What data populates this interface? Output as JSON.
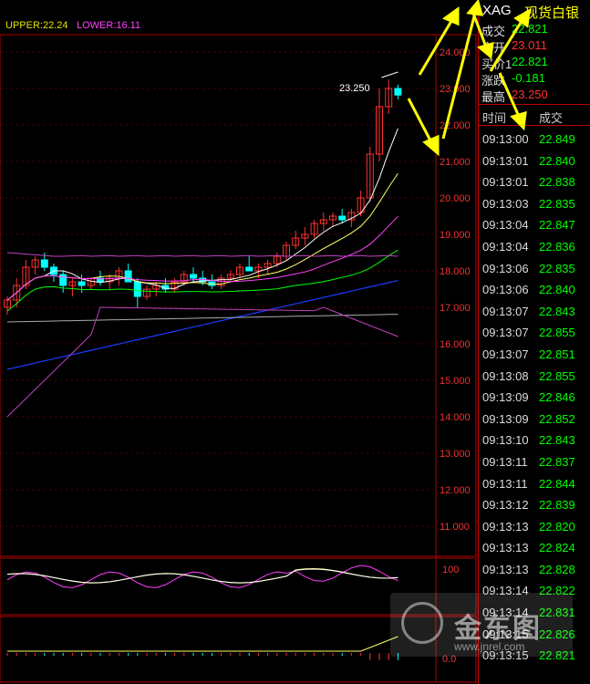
{
  "indicator": {
    "upper": "UPPER:22.24",
    "lower": "LOWER:16.11"
  },
  "price_tag": "23.250",
  "axis": {
    "main_labels": [
      "24.000",
      "23.000",
      "22.000",
      "21.000",
      "20.000",
      "19.000",
      "18.000",
      "17.000",
      "16.000",
      "15.000",
      "14.000",
      "13.000",
      "12.000",
      "11.000"
    ],
    "osc_labels": [
      "100"
    ],
    "vol_labels": [
      "0.0"
    ]
  },
  "colors": {
    "up": "#ff3030",
    "down": "#00ffff",
    "grid": "#b00000",
    "upper_band": "#e5e500",
    "lower_band": "#ff40ff",
    "ma_long": "#1a3cff"
  },
  "quote": {
    "symbol": "XAG",
    "name": "现货白银",
    "rows": [
      {
        "key": "成交",
        "value": "22.821",
        "color": "green"
      },
      {
        "key": "今开",
        "value": "23.011",
        "color": "red"
      },
      {
        "key": "买价1",
        "value": "22.821",
        "color": "green"
      },
      {
        "key": "涨跌",
        "value": "-0.181",
        "color": "green"
      },
      {
        "key": "最高",
        "value": "23.250",
        "color": "red"
      }
    ]
  },
  "ticks_header": {
    "time": "时间",
    "price": "成交"
  },
  "ticks": [
    {
      "time": "09:13:00",
      "price": "22.849"
    },
    {
      "time": "09:13:01",
      "price": "22.840"
    },
    {
      "time": "09:13:01",
      "price": "22.838"
    },
    {
      "time": "09:13:03",
      "price": "22.835"
    },
    {
      "time": "09:13:04",
      "price": "22.847"
    },
    {
      "time": "09:13:04",
      "price": "22.836"
    },
    {
      "time": "09:13:06",
      "price": "22.835"
    },
    {
      "time": "09:13:06",
      "price": "22.840"
    },
    {
      "time": "09:13:07",
      "price": "22.843"
    },
    {
      "time": "09:13:07",
      "price": "22.855"
    },
    {
      "time": "09:13:07",
      "price": "22.851"
    },
    {
      "time": "09:13:08",
      "price": "22.855"
    },
    {
      "time": "09:13:09",
      "price": "22.846"
    },
    {
      "time": "09:13:09",
      "price": "22.852"
    },
    {
      "time": "09:13:10",
      "price": "22.843"
    },
    {
      "time": "09:13:11",
      "price": "22.837"
    },
    {
      "time": "09:13:11",
      "price": "22.844"
    },
    {
      "time": "09:13:12",
      "price": "22.839"
    },
    {
      "time": "09:13:13",
      "price": "22.820"
    },
    {
      "time": "09:13:13",
      "price": "22.824"
    },
    {
      "time": "09:13:13",
      "price": "22.828"
    },
    {
      "time": "09:13:14",
      "price": "22.822"
    },
    {
      "time": "09:13:14",
      "price": "22.831"
    },
    {
      "time": "09:13:15",
      "price": "22.826"
    },
    {
      "time": "09:13:15",
      "price": "22.821"
    }
  ],
  "watermark": {
    "brand": "金东图",
    "url": "www.jnrel.com"
  },
  "candles": [
    [
      17.0,
      17.3,
      16.8,
      17.2
    ],
    [
      17.2,
      17.8,
      17.0,
      17.6
    ],
    [
      17.6,
      18.3,
      17.5,
      18.1
    ],
    [
      18.1,
      18.4,
      17.9,
      18.3
    ],
    [
      18.3,
      18.5,
      18.0,
      18.1
    ],
    [
      18.1,
      18.2,
      17.7,
      17.9
    ],
    [
      17.9,
      18.0,
      17.4,
      17.6
    ],
    [
      17.6,
      17.8,
      17.3,
      17.7
    ],
    [
      17.7,
      17.9,
      17.4,
      17.6
    ],
    [
      17.6,
      17.8,
      17.5,
      17.8
    ],
    [
      17.8,
      18.0,
      17.6,
      17.7
    ],
    [
      17.7,
      17.9,
      17.5,
      17.8
    ],
    [
      17.8,
      18.1,
      17.6,
      18.0
    ],
    [
      18.0,
      18.2,
      17.7,
      17.7
    ],
    [
      17.7,
      17.8,
      17.0,
      17.3
    ],
    [
      17.3,
      17.6,
      17.2,
      17.5
    ],
    [
      17.5,
      17.7,
      17.3,
      17.6
    ],
    [
      17.6,
      17.8,
      17.4,
      17.5
    ],
    [
      17.5,
      17.8,
      17.4,
      17.7
    ],
    [
      17.7,
      18.0,
      17.6,
      17.9
    ],
    [
      17.9,
      18.1,
      17.7,
      17.8
    ],
    [
      17.8,
      18.0,
      17.6,
      17.7
    ],
    [
      17.7,
      17.9,
      17.5,
      17.6
    ],
    [
      17.6,
      17.9,
      17.5,
      17.8
    ],
    [
      17.8,
      18.0,
      17.7,
      17.9
    ],
    [
      17.9,
      18.2,
      17.8,
      18.1
    ],
    [
      18.1,
      18.4,
      18.0,
      18.0
    ],
    [
      18.0,
      18.2,
      17.8,
      18.1
    ],
    [
      18.1,
      18.3,
      17.9,
      18.2
    ],
    [
      18.2,
      18.5,
      18.1,
      18.4
    ],
    [
      18.4,
      18.8,
      18.3,
      18.7
    ],
    [
      18.7,
      19.1,
      18.6,
      18.9
    ],
    [
      18.9,
      19.2,
      18.7,
      19.0
    ],
    [
      19.0,
      19.4,
      18.9,
      19.3
    ],
    [
      19.3,
      19.6,
      19.1,
      19.4
    ],
    [
      19.4,
      19.6,
      19.2,
      19.5
    ],
    [
      19.5,
      19.7,
      19.3,
      19.4
    ],
    [
      19.4,
      19.7,
      19.2,
      19.6
    ],
    [
      19.6,
      20.2,
      19.5,
      20.0
    ],
    [
      20.0,
      21.4,
      19.9,
      21.2
    ],
    [
      21.2,
      23.0,
      21.0,
      22.5
    ],
    [
      22.5,
      23.25,
      22.3,
      23.0
    ],
    [
      23.0,
      23.1,
      22.7,
      22.82
    ]
  ]
}
